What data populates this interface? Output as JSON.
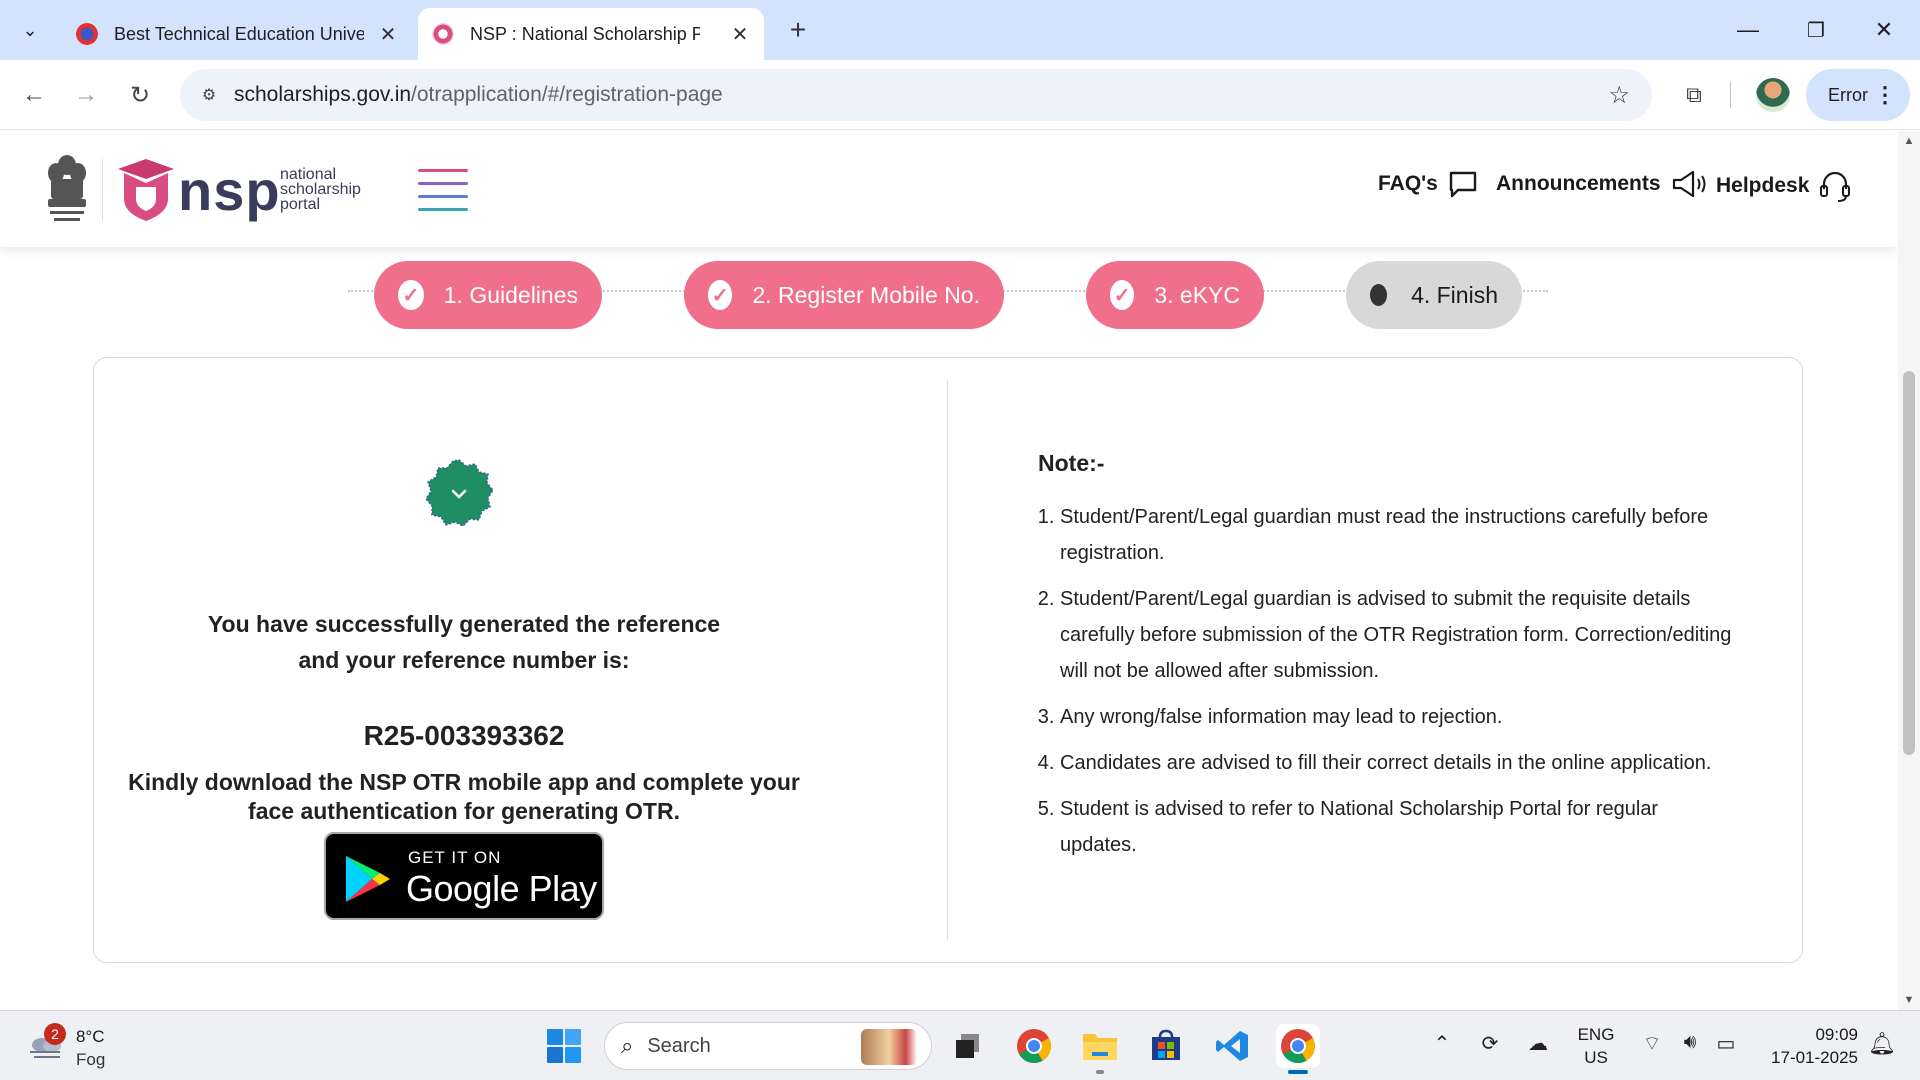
{
  "browser": {
    "tabs": [
      {
        "title": "Best Technical Education University",
        "close": "✕"
      },
      {
        "title": "NSP : National Scholarship Portal",
        "close": "✕",
        "active": true
      }
    ],
    "new_tab": "+",
    "window": {
      "minimize": "—",
      "restore": "❐",
      "close": "✕"
    },
    "url_host": "scholarships.gov.in",
    "url_path": "/otrapplication/#/registration-page",
    "profile_button_label": "Error"
  },
  "site": {
    "brand_word": "nsp",
    "brand_sub": [
      "national",
      "scholarship",
      "portal"
    ],
    "nav": [
      {
        "label": "FAQ's",
        "icon": "chat-icon"
      },
      {
        "label": "Announcements",
        "icon": "megaphone-icon"
      },
      {
        "label": "Helpdesk",
        "icon": "headset-icon"
      }
    ]
  },
  "stepper": {
    "steps": [
      {
        "label": "1. Guidelines",
        "state": "done"
      },
      {
        "label": "2. Register Mobile No.",
        "state": "done"
      },
      {
        "label": "3. eKYC",
        "state": "done"
      },
      {
        "label": "4. Finish",
        "state": "current"
      }
    ],
    "colors": {
      "done": "#f06f8a",
      "current": "#d8d8d8"
    }
  },
  "result": {
    "success_message": "You have successfully generated the reference and your reference number is:",
    "reference_number": "R25-003393362",
    "download_message": "Kindly download the NSP OTR mobile app and complete your face authentication for generating OTR.",
    "store_badge": {
      "small": "GET IT ON",
      "big": "Google Play"
    }
  },
  "notes": {
    "title": "Note:-",
    "items": [
      "Student/Parent/Legal guardian must read the instructions carefully before registration.",
      "Student/Parent/Legal guardian is advised to submit the requisite details carefully before submission of the OTR Registration form. Correction/editing will not be allowed after submission.",
      "Any wrong/false information may lead to rejection.",
      "Candidates are advised to fill their correct details in the online application.",
      "Student is advised to refer to National Scholarship Portal for regular updates."
    ]
  },
  "taskbar": {
    "weather": {
      "badge": "2",
      "temp": "8°C",
      "condition": "Fog"
    },
    "search_placeholder": "Search",
    "lang": [
      "ENG",
      "US"
    ],
    "time": "09:09",
    "date": "17-01-2025"
  }
}
